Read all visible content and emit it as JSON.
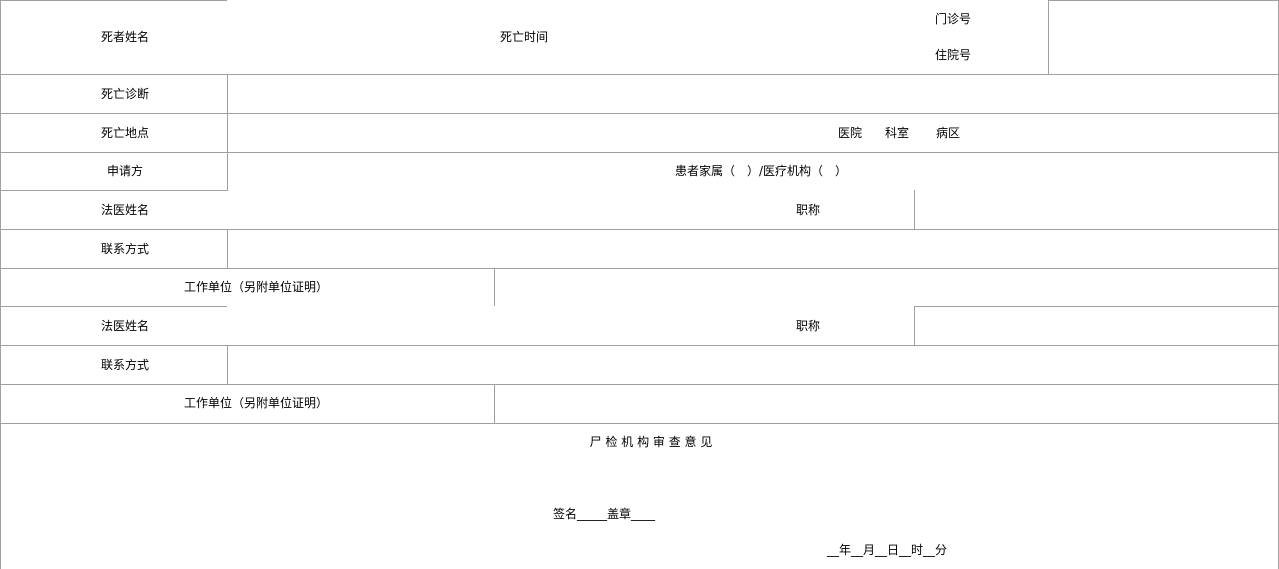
{
  "form": {
    "row1": {
      "deceased_name_label": "死者姓名",
      "death_time_label": "死亡时间",
      "outpatient_no_label": "门诊号",
      "inpatient_no_label": "住院号"
    },
    "death_diagnosis_label": "死亡诊断",
    "death_place": {
      "label": "死亡地点",
      "hospital": "医院",
      "department": "科室",
      "ward": "病区"
    },
    "applicant": {
      "label": "申请方",
      "options": "患者家属（　）/医疗机构（　）"
    },
    "examiner1": {
      "name_label": "法医姓名",
      "title_label": "职称",
      "contact_label": "联系方式",
      "workplace_label": "工作单位（另附单位证明）"
    },
    "examiner2": {
      "name_label": "法医姓名",
      "title_label": "职称",
      "contact_label": "联系方式",
      "workplace_label": "工作单位（另附单位证明）"
    },
    "review": {
      "title": "尸 检 机 构 审 查 意 见",
      "sign_line": "签名_____盖章____",
      "date_line": "__年__月__日__时__分"
    }
  }
}
